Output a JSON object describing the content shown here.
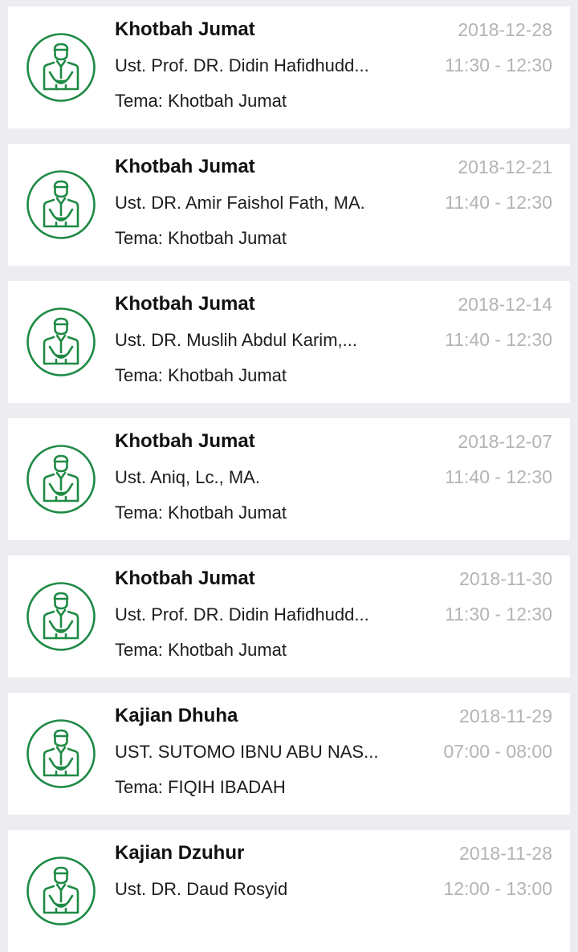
{
  "theme_colors": {
    "accent": "#1e8a44",
    "muted_text": "#b3b3b8",
    "background": "#ececf1"
  },
  "schedule": {
    "items": [
      {
        "title": "Khotbah Jumat",
        "speaker": "Ust. Prof. DR. Didin Hafidhudd...",
        "theme": "Tema: Khotbah Jumat",
        "date": "2018-12-28",
        "time": "11:30 - 12:30",
        "icon": "imam-icon"
      },
      {
        "title": "Khotbah Jumat",
        "speaker": "Ust. DR. Amir Faishol Fath, MA.",
        "theme": "Tema: Khotbah Jumat",
        "date": "2018-12-21",
        "time": "11:40 - 12:30",
        "icon": "imam-icon"
      },
      {
        "title": "Khotbah Jumat",
        "speaker": "Ust. DR. Muslih Abdul Karim,...",
        "theme": "Tema: Khotbah Jumat",
        "date": "2018-12-14",
        "time": "11:40 - 12:30",
        "icon": "imam-icon"
      },
      {
        "title": "Khotbah Jumat",
        "speaker": "Ust. Aniq, Lc., MA.",
        "theme": "Tema: Khotbah Jumat",
        "date": "2018-12-07",
        "time": "11:40 - 12:30",
        "icon": "imam-icon"
      },
      {
        "title": "Khotbah Jumat",
        "speaker": "Ust. Prof. DR. Didin Hafidhudd...",
        "theme": "Tema: Khotbah Jumat",
        "date": "2018-11-30",
        "time": "11:30 - 12:30",
        "icon": "imam-icon"
      },
      {
        "title": "Kajian Dhuha",
        "speaker": "UST. SUTOMO IBNU ABU NAS...",
        "theme": "Tema: FIQIH IBADAH",
        "date": "2018-11-29",
        "time": "07:00 - 08:00",
        "icon": "imam-icon"
      },
      {
        "title": "Kajian Dzuhur",
        "speaker": "Ust. DR. Daud Rosyid",
        "theme": "",
        "date": "2018-11-28",
        "time": "12:00 - 13:00",
        "icon": "imam-icon"
      }
    ]
  }
}
